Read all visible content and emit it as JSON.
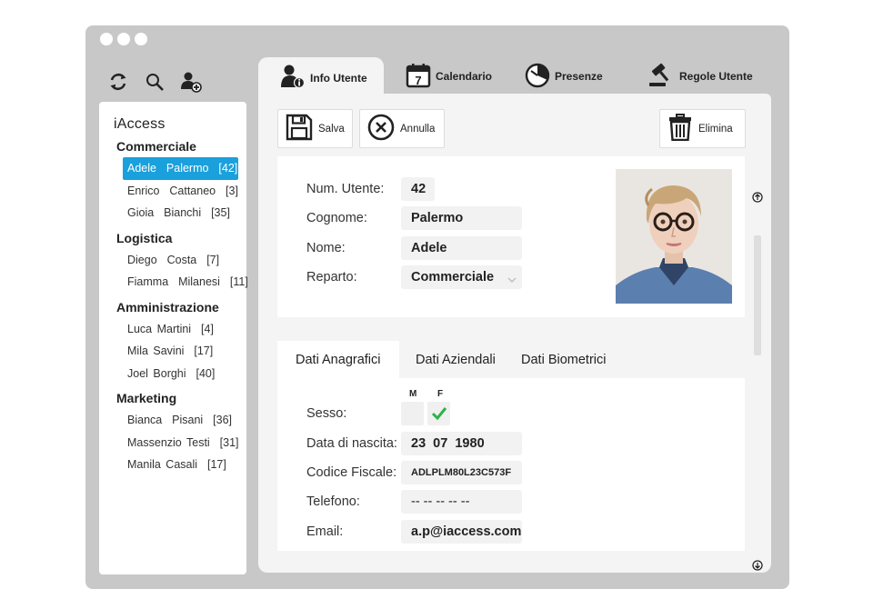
{
  "toolbar_icons": [
    "refresh-icon",
    "search-icon",
    "add-user-icon"
  ],
  "sidebar": {
    "title": "iAccess",
    "groups": [
      {
        "label": "Commerciale",
        "users": [
          "Adele  Palermo  [42]",
          "Enrico  Cattaneo  [3]",
          "Gioia  Bianchi  [35]"
        ]
      },
      {
        "label": "Logistica",
        "users": [
          "Diego  Costa  [7]",
          "Fiamma  Milanesi  [11]"
        ]
      },
      {
        "label": "Amministrazione",
        "users": [
          "Luca Martini  [4]",
          "Mila Savini  [17]",
          "Joel Borghi  [40]"
        ]
      },
      {
        "label": "Marketing",
        "users": [
          "Bianca  Pisani  [36]",
          "Massenzio Testi  [31]",
          "Manila Casali  [17]"
        ]
      }
    ],
    "selected": "Adele  Palermo  [42]"
  },
  "top_tabs": [
    {
      "label": "Info Utente",
      "icon": "user-info-icon",
      "active": true
    },
    {
      "label": "Calendario",
      "icon": "calendar-icon",
      "active": false
    },
    {
      "label": "Presenze",
      "icon": "clock-icon",
      "active": false
    },
    {
      "label": "Regole Utente",
      "icon": "gavel-icon",
      "active": false
    }
  ],
  "calendar_day": "7",
  "buttons": {
    "save": "Salva",
    "cancel": "Annulla",
    "delete": "Elimina"
  },
  "info": {
    "num_label": "Num. Utente:",
    "num_value": "42",
    "surname_label": "Cognome:",
    "surname_value": "Palermo",
    "name_label": "Nome:",
    "name_value": "Adele",
    "dept_label": "Reparto:",
    "dept_value": "Commerciale"
  },
  "sub_tabs": [
    {
      "label": "Dati Anagrafici",
      "active": true
    },
    {
      "label": "Dati Aziendali",
      "active": false
    },
    {
      "label": "Dati Biometrici",
      "active": false
    }
  ],
  "anagrafici": {
    "sex_label": "Sesso:",
    "sex_m": "M",
    "sex_f": "F",
    "sex_selected": "F",
    "birth_label": "Data di nascita:",
    "birth_value": "23  07  1980",
    "cf_label": "Codice Fiscale:",
    "cf_value": "ADLPLM80L23C573F",
    "phone_label": "Telefono:",
    "phone_value": "-- -- -- -- --",
    "email_label": "Email:",
    "email_value": "a.p@iaccess.com"
  },
  "colors": {
    "accent": "#1aa0dc",
    "check": "#2db34a",
    "window": "#c8c8c8",
    "panel": "#f4f4f4"
  }
}
